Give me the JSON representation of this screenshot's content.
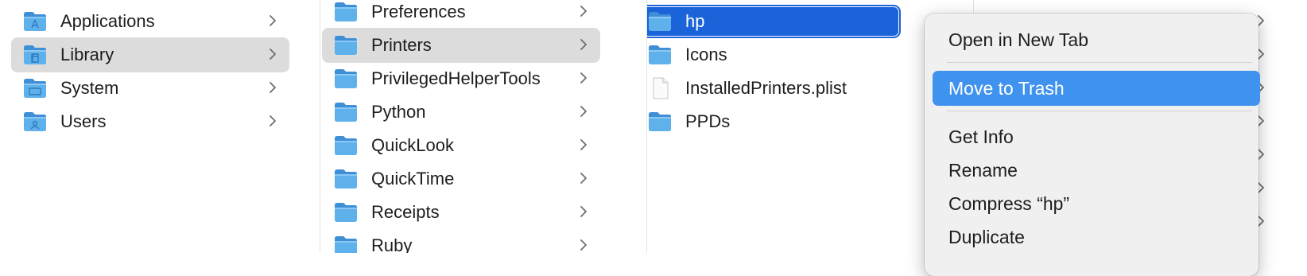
{
  "columns": [
    {
      "items": [
        {
          "label": "Applications",
          "icon": "applications-folder-icon",
          "kind": "folder",
          "badge": "apps",
          "state": "normal"
        },
        {
          "label": "Library",
          "icon": "library-folder-icon",
          "kind": "folder",
          "badge": "library",
          "state": "selected-inactive"
        },
        {
          "label": "System",
          "icon": "system-folder-icon",
          "kind": "folder",
          "badge": "system",
          "state": "normal"
        },
        {
          "label": "Users",
          "icon": "users-folder-icon",
          "kind": "folder",
          "badge": "users",
          "state": "normal"
        }
      ]
    },
    {
      "items": [
        {
          "label": "Preferences",
          "icon": "folder-icon",
          "kind": "folder",
          "state": "normal"
        },
        {
          "label": "Printers",
          "icon": "folder-icon",
          "kind": "folder",
          "state": "selected-inactive"
        },
        {
          "label": "PrivilegedHelperTools",
          "icon": "folder-icon",
          "kind": "folder",
          "state": "normal"
        },
        {
          "label": "Python",
          "icon": "folder-icon",
          "kind": "folder",
          "state": "normal"
        },
        {
          "label": "QuickLook",
          "icon": "folder-icon",
          "kind": "folder",
          "state": "normal"
        },
        {
          "label": "QuickTime",
          "icon": "folder-icon",
          "kind": "folder",
          "state": "normal"
        },
        {
          "label": "Receipts",
          "icon": "folder-icon",
          "kind": "folder",
          "state": "normal"
        },
        {
          "label": "Ruby",
          "icon": "folder-icon",
          "kind": "folder",
          "state": "normal"
        }
      ]
    },
    {
      "items": [
        {
          "label": "hp",
          "icon": "folder-icon",
          "kind": "folder",
          "state": "selected-active"
        },
        {
          "label": "Icons",
          "icon": "folder-icon",
          "kind": "folder",
          "state": "normal"
        },
        {
          "label": "InstalledPrinters.plist",
          "icon": "document-icon",
          "kind": "file",
          "state": "normal"
        },
        {
          "label": "PPDs",
          "icon": "folder-icon",
          "kind": "folder",
          "state": "normal"
        }
      ]
    }
  ],
  "context_menu": {
    "items": [
      {
        "label": "Open in New Tab",
        "highlighted": false
      },
      {
        "separator": true
      },
      {
        "label": "Move to Trash",
        "highlighted": true
      },
      {
        "separator": true
      },
      {
        "label": "Get Info",
        "highlighted": false
      },
      {
        "label": "Rename",
        "highlighted": false
      },
      {
        "label": "Compress “hp”",
        "highlighted": false
      },
      {
        "label": "Duplicate",
        "highlighted": false
      }
    ]
  },
  "colors": {
    "selection_blue": "#1b63d8",
    "selection_gray": "#dcdcdc",
    "menu_highlight": "#3f93ef",
    "folder_blue": "#5fb1ec"
  }
}
